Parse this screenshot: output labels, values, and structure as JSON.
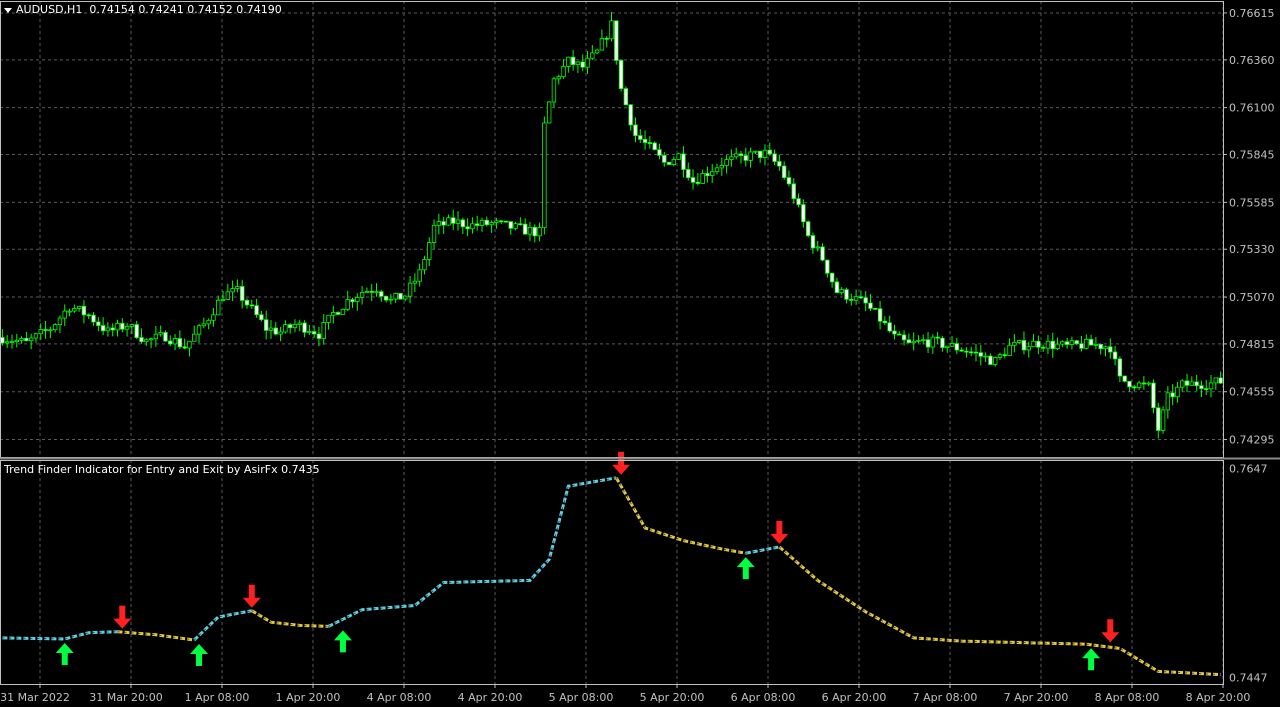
{
  "header": {
    "symbol": "AUDUSD,H1",
    "ohlc": "0.74154 0.74241 0.74152 0.74190"
  },
  "indicator": {
    "title": "Trend Finder Indicator for Entry and Exit by AsirFx 0.7435"
  },
  "colors": {
    "background": "#000000",
    "grid": "#5a5a5a",
    "axis": "#c0c0c0",
    "candle": "#00ff00",
    "bull_body": "#000000",
    "bear_body": "#ffffff",
    "up_trend": "#5fd0e0",
    "down_trend": "#e0c840",
    "buy_arrow": "#00ff40",
    "sell_arrow": "#ff2020"
  },
  "chart_data": [
    {
      "type": "candlestick",
      "y_ticks": [
        "0.76615",
        "0.76360",
        "0.76100",
        "0.75845",
        "0.75585",
        "0.75330",
        "0.75070",
        "0.74815",
        "0.74555",
        "0.74295"
      ],
      "ylim": [
        0.742,
        0.7668
      ],
      "x_ticks": [
        "31 Mar 2022",
        "31 Mar 20:00",
        "1 Apr 08:00",
        "1 Apr 20:00",
        "4 Apr 08:00",
        "4 Apr 20:00",
        "5 Apr 08:00",
        "5 Apr 20:00",
        "6 Apr 08:00",
        "6 Apr 20:00",
        "7 Apr 08:00",
        "7 Apr 20:00",
        "8 Apr 08:00",
        "8 Apr 20:00"
      ],
      "grid": true,
      "close_path": [
        [
          0,
          0.7485
        ],
        [
          5,
          0.7482
        ],
        [
          10,
          0.749
        ],
        [
          14,
          0.7502
        ],
        [
          18,
          0.7497
        ],
        [
          22,
          0.7488
        ],
        [
          26,
          0.7492
        ],
        [
          30,
          0.7483
        ],
        [
          34,
          0.7486
        ],
        [
          38,
          0.748
        ],
        [
          42,
          0.7492
        ],
        [
          46,
          0.7508
        ],
        [
          49,
          0.751
        ],
        [
          52,
          0.75
        ],
        [
          55,
          0.749
        ],
        [
          58,
          0.7488
        ],
        [
          61,
          0.7492
        ],
        [
          64,
          0.749
        ],
        [
          66,
          0.7487
        ],
        [
          69,
          0.7498
        ],
        [
          72,
          0.7505
        ],
        [
          75,
          0.751
        ],
        [
          78,
          0.7512
        ],
        [
          81,
          0.7505
        ],
        [
          84,
          0.7508
        ],
        [
          87,
          0.752
        ],
        [
          90,
          0.7545
        ],
        [
          94,
          0.7548
        ],
        [
          98,
          0.7546
        ],
        [
          102,
          0.7547
        ],
        [
          106,
          0.7545
        ],
        [
          110,
          0.7543
        ],
        [
          112,
          0.7542
        ],
        [
          113,
          0.76
        ],
        [
          115,
          0.7625
        ],
        [
          118,
          0.7635
        ],
        [
          121,
          0.7632
        ],
        [
          124,
          0.764
        ],
        [
          127,
          0.7655
        ],
        [
          129,
          0.762
        ],
        [
          132,
          0.7595
        ],
        [
          135,
          0.7588
        ],
        [
          138,
          0.758
        ],
        [
          141,
          0.7584
        ],
        [
          144,
          0.757
        ],
        [
          147,
          0.7575
        ],
        [
          150,
          0.758
        ],
        [
          153,
          0.7582
        ],
        [
          156,
          0.7584
        ],
        [
          159,
          0.7585
        ],
        [
          162,
          0.7578
        ],
        [
          165,
          0.7562
        ],
        [
          168,
          0.754
        ],
        [
          171,
          0.7528
        ],
        [
          174,
          0.751
        ],
        [
          177,
          0.7507
        ],
        [
          180,
          0.7503
        ],
        [
          183,
          0.7495
        ],
        [
          186,
          0.7485
        ],
        [
          189,
          0.7481
        ],
        [
          192,
          0.7483
        ],
        [
          195,
          0.7482
        ],
        [
          198,
          0.748
        ],
        [
          201,
          0.7478
        ],
        [
          204,
          0.7475
        ],
        [
          207,
          0.7472
        ],
        [
          210,
          0.748
        ],
        [
          213,
          0.7481
        ],
        [
          216,
          0.7482
        ],
        [
          219,
          0.7481
        ],
        [
          222,
          0.748
        ],
        [
          225,
          0.7481
        ],
        [
          228,
          0.7481
        ],
        [
          231,
          0.748
        ],
        [
          233,
          0.7462
        ],
        [
          236,
          0.746
        ],
        [
          239,
          0.7458
        ],
        [
          241,
          0.7435
        ],
        [
          243,
          0.7452
        ],
        [
          246,
          0.7459
        ],
        [
          249,
          0.746
        ],
        [
          252,
          0.746
        ],
        [
          254,
          0.7461
        ]
      ]
    },
    {
      "type": "line",
      "name": "Trend Finder Indicator for Entry and Exit by AsirFx",
      "y_ticks": [
        "0.7647",
        "0.7447"
      ],
      "ylim": [
        0.7441,
        0.7655
      ],
      "series": [
        {
          "trend": "up",
          "points": [
            [
              0,
              0.7485
            ],
            [
              13,
              0.7484
            ],
            [
              18,
              0.749
            ],
            [
              24,
              0.7491
            ]
          ]
        },
        {
          "trend": "down",
          "points": [
            [
              24,
              0.7491
            ],
            [
              32,
              0.7488
            ],
            [
              40,
              0.7483
            ]
          ]
        },
        {
          "trend": "up",
          "points": [
            [
              40,
              0.7483
            ],
            [
              45,
              0.7505
            ],
            [
              52,
              0.7511
            ]
          ]
        },
        {
          "trend": "down",
          "points": [
            [
              52,
              0.7511
            ],
            [
              56,
              0.75
            ],
            [
              62,
              0.7497
            ],
            [
              68,
              0.7496
            ]
          ]
        },
        {
          "trend": "up",
          "points": [
            [
              68,
              0.7496
            ],
            [
              75,
              0.7512
            ],
            [
              86,
              0.7516
            ],
            [
              92,
              0.7538
            ],
            [
              110,
              0.754
            ],
            [
              114,
              0.756
            ],
            [
              118,
              0.763
            ],
            [
              128,
              0.7638
            ]
          ]
        },
        {
          "trend": "down",
          "points": [
            [
              128,
              0.7638
            ],
            [
              134,
              0.759
            ],
            [
              142,
              0.7578
            ],
            [
              150,
              0.757
            ],
            [
              155,
              0.7566
            ]
          ]
        },
        {
          "trend": "up",
          "points": [
            [
              155,
              0.7566
            ],
            [
              162,
              0.7572
            ]
          ]
        },
        {
          "trend": "down",
          "points": [
            [
              162,
              0.7572
            ],
            [
              170,
              0.754
            ],
            [
              180,
              0.751
            ],
            [
              190,
              0.7485
            ],
            [
              200,
              0.7482
            ],
            [
              226,
              0.7479
            ],
            [
              233,
              0.7475
            ],
            [
              241,
              0.7453
            ],
            [
              254,
              0.745
            ]
          ]
        }
      ],
      "signals": [
        {
          "type": "buy",
          "x": 13,
          "value": 0.7484
        },
        {
          "type": "sell",
          "x": 25,
          "value": 0.7491
        },
        {
          "type": "buy",
          "x": 41,
          "value": 0.7483
        },
        {
          "type": "sell",
          "x": 52,
          "value": 0.7511
        },
        {
          "type": "buy",
          "x": 71,
          "value": 0.7496
        },
        {
          "type": "sell",
          "x": 129,
          "value": 0.7638
        },
        {
          "type": "buy",
          "x": 155,
          "value": 0.7566
        },
        {
          "type": "sell",
          "x": 162,
          "value": 0.7572
        },
        {
          "type": "buy",
          "x": 227,
          "value": 0.7479
        },
        {
          "type": "sell",
          "x": 231,
          "value": 0.7478
        }
      ]
    }
  ]
}
